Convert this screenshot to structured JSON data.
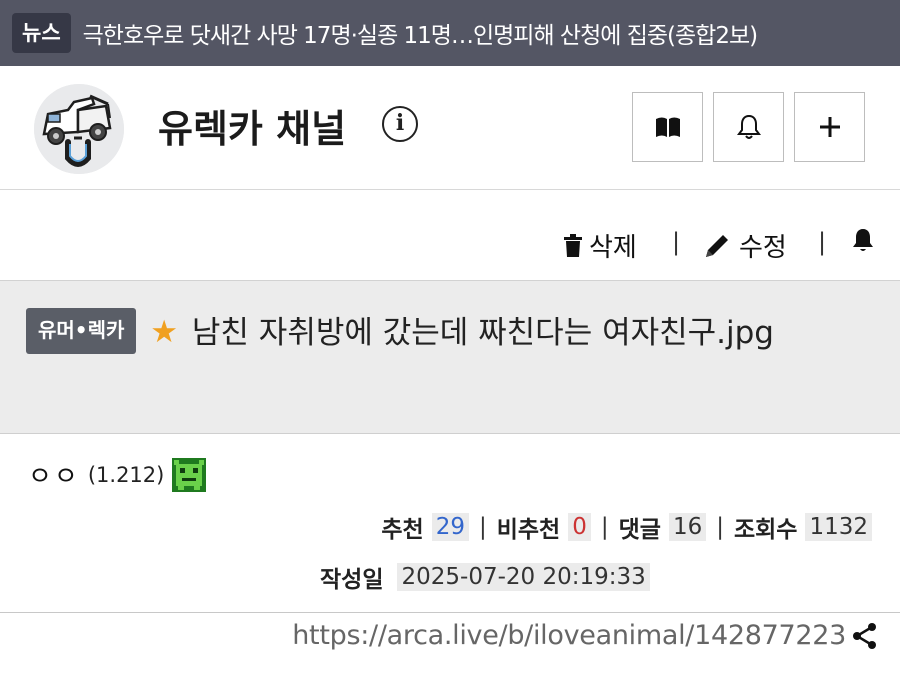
{
  "news": {
    "badge": "뉴스",
    "headline": "극한호우로 닷새간 사망 17명·실종 11명…인명피해 산청에 집중(종합2보)"
  },
  "channel": {
    "name": "유렉카 채널",
    "info_glyph": "i",
    "buttons": [
      "book-icon",
      "bell-icon",
      "plus-icon"
    ]
  },
  "actions": {
    "delete_label": "삭제",
    "edit_label": "수정",
    "separator": "|"
  },
  "post": {
    "category": "유머•렉카",
    "star": "★",
    "title": "남친 자취방에 갔는데 짜친다는 여자친구.jpg"
  },
  "author": {
    "name": "ㅇㅇ",
    "score": "(1.212)"
  },
  "stats": {
    "upvote_label": "추천",
    "upvote_value": "29",
    "downvote_label": "비추천",
    "downvote_value": "0",
    "comment_label": "댓글",
    "comment_value": "16",
    "views_label": "조회수",
    "views_value": "1132",
    "separator": "|",
    "date_label": "작성일",
    "date_value": "2025-07-20 20:19:33"
  },
  "link": {
    "url": "https://arca.live/b/iloveanimal/142877223"
  },
  "colors": {
    "upvote": "#3366cc",
    "downvote": "#cc3333",
    "star": "#f0a020",
    "news_bar": "#545664"
  }
}
